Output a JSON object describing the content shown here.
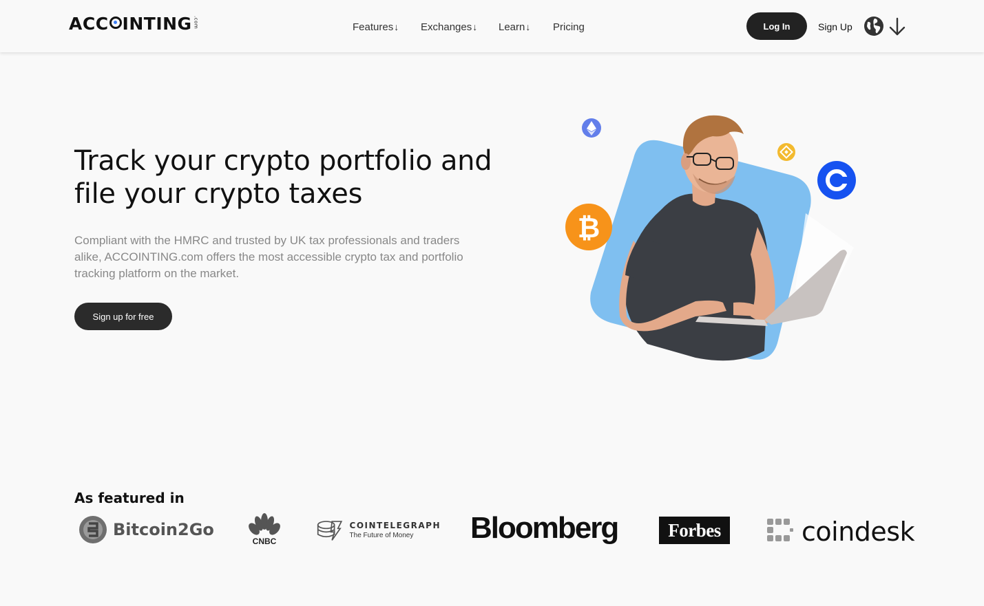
{
  "header": {
    "logo_text_left": "ACC",
    "logo_text_right": "INTING",
    "logo_suffix": ".com",
    "nav": [
      {
        "label": "Features",
        "icon": "chevron-down-icon"
      },
      {
        "label": "Exchanges",
        "icon": "chevron-down-icon"
      },
      {
        "label": "Learn",
        "icon": "chevron-down-icon"
      },
      {
        "label": "Pricing"
      }
    ],
    "login_label": "Log In",
    "signup_label": "Sign Up",
    "language_icon": "globe-icon",
    "language_dropdown_icon": "arrow-down-icon"
  },
  "hero": {
    "title": "Track your crypto portfolio and file your crypto taxes",
    "subtitle": "Compliant with the HMRC and trusted by UK tax professionals and traders alike, ACCOINTING.com offers the most accessible crypto tax and portfolio tracking platform on the market.",
    "cta_label": "Sign up for free",
    "illustration_icons": [
      "ethereum-icon",
      "binance-coin-icon",
      "coinbase-icon",
      "bitcoin-icon"
    ]
  },
  "featured": {
    "heading": "As featured in",
    "logos": [
      {
        "name": "Bitcoin2Go",
        "text": "Bitcoin2Go"
      },
      {
        "name": "CNBC",
        "text": "CNBC"
      },
      {
        "name": "Cointelegraph",
        "text": "COINTELEGRAPH",
        "tagline": "The Future of Money"
      },
      {
        "name": "Bloomberg",
        "text": "Bloomberg"
      },
      {
        "name": "Forbes",
        "text": "Forbes"
      },
      {
        "name": "coindesk",
        "text": "coindesk"
      }
    ]
  },
  "colors": {
    "background": "#f9f9f9",
    "button_dark": "#222222",
    "accent_blue": "#3d7ff5",
    "bitcoin_orange": "#f7931a",
    "coinbase_blue": "#1652f0",
    "ethereum_purple": "#627eea",
    "binance_yellow": "#f3ba2f",
    "hero_shape": "#7fbff0"
  }
}
